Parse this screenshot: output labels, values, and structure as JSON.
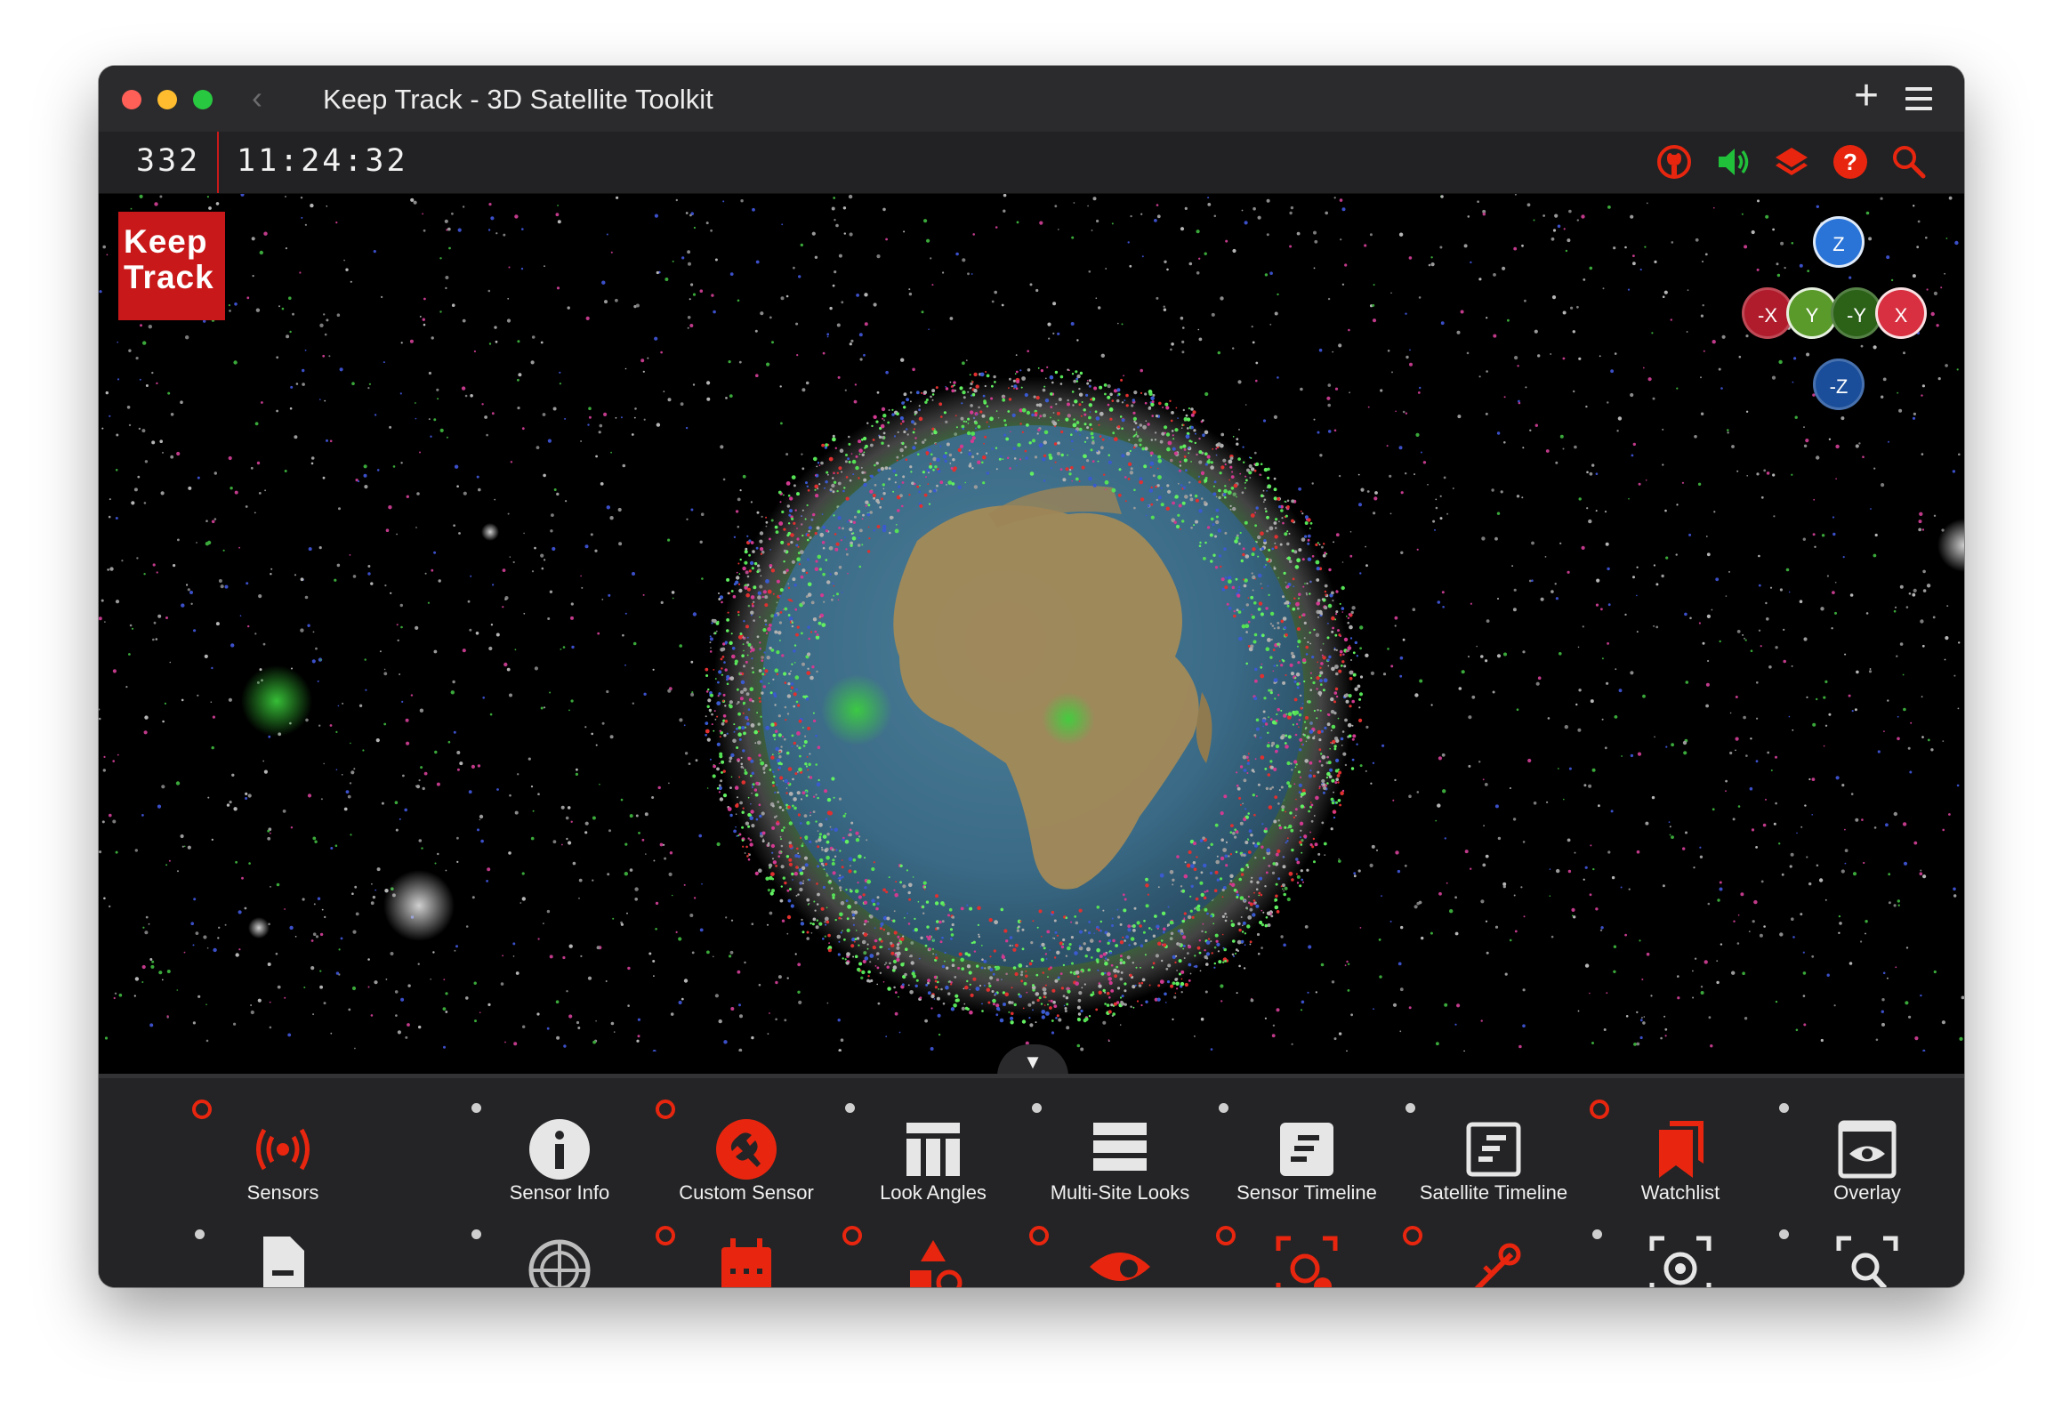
{
  "window": {
    "title": "Keep Track - 3D Satellite Toolkit"
  },
  "topbar": {
    "fps": "332",
    "clock": "11:24:32",
    "icons": [
      "github-icon",
      "sound-icon",
      "layers-icon",
      "help-icon",
      "search-icon"
    ]
  },
  "logo": {
    "line1": "Keep",
    "line2": "Track"
  },
  "axis_controls": {
    "z": "Z",
    "neg_z": "-Z",
    "x": "X",
    "neg_x": "-X",
    "y": "Y",
    "neg_y": "-Y"
  },
  "bottom_menu": {
    "row1": [
      {
        "label": "Sensors",
        "icon": "sensors-icon",
        "marker": "red"
      },
      {
        "label": "Sensor Info",
        "icon": "info-icon",
        "marker": "grey"
      },
      {
        "label": "Custom Sensor",
        "icon": "wrench-icon",
        "marker": "red"
      },
      {
        "label": "Look Angles",
        "icon": "table-icon",
        "marker": "grey"
      },
      {
        "label": "Multi-Site Looks",
        "icon": "list-icon",
        "marker": "grey"
      },
      {
        "label": "Sensor Timeline",
        "icon": "sensor-timeline-icon",
        "marker": "grey"
      },
      {
        "label": "Satellite Timeline",
        "icon": "satellite-timeline-icon",
        "marker": "grey"
      },
      {
        "label": "Watchlist",
        "icon": "bookmarks-icon",
        "marker": "red"
      },
      {
        "label": "Overlay",
        "icon": "eye-icon",
        "marker": "grey"
      }
    ],
    "row2_icons": [
      "document-icon",
      "radar-icon",
      "calendar-icon",
      "shapes-icon",
      "visibility-icon",
      "sensor-target-icon",
      "satellite-icon",
      "focus-target-icon",
      "zoom-search-icon"
    ]
  },
  "colors": {
    "accent_red": "#e8260f",
    "brand_red": "#c8181a",
    "sound_green": "#21c03a",
    "axis_z": "#2a74d8",
    "axis_x": "#d83040",
    "axis_y": "#5a9a2a"
  },
  "collapse_toggle": "▼"
}
